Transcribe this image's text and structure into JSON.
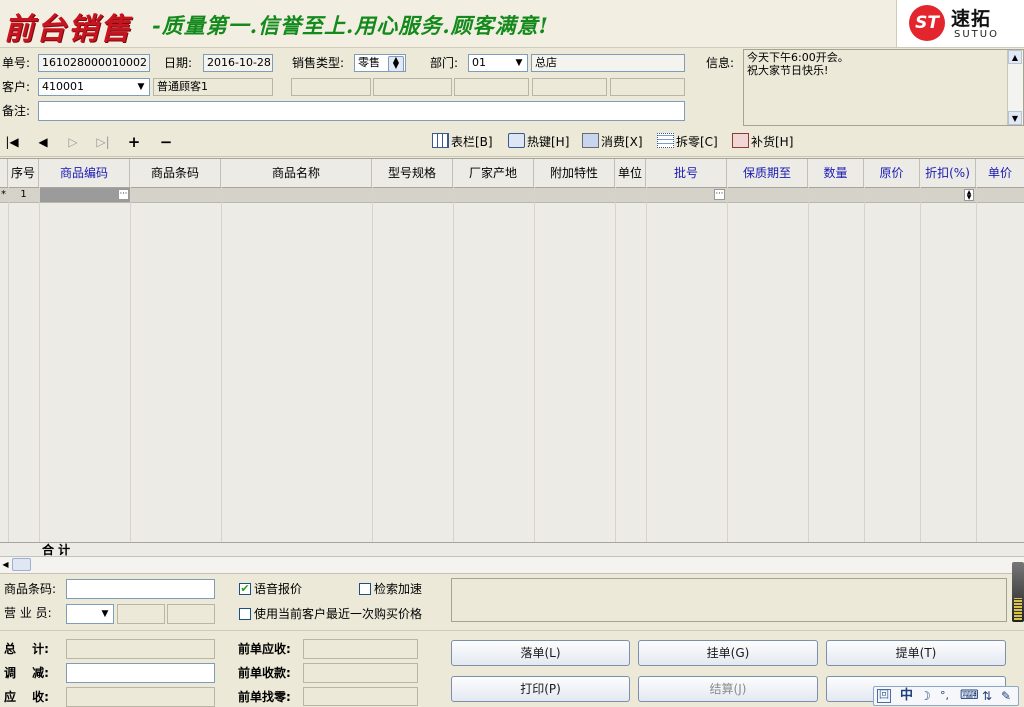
{
  "banner": {
    "title": "前台销售",
    "slogan": "-质量第一.信誉至上.用心服务.顾客满意!",
    "logo_mark": "ST",
    "logo_cn": "速拓",
    "logo_en": "SUTUO"
  },
  "form": {
    "order_no_label": "单号:",
    "order_no": "161028000010002",
    "date_label": "日期:",
    "date": "2016-10-28",
    "sale_type_label": "销售类型:",
    "sale_type": "零售",
    "dept_label": "部门:",
    "dept_code": "01",
    "dept_name": "总店",
    "info_label": "信息:",
    "info_line1": "今天下午6:00开会。",
    "info_line2": "祝大家节日快乐!",
    "customer_label": "客户:",
    "customer_code": "410001",
    "customer_name": "普通顾客1",
    "note_label": "备注:"
  },
  "toolbar": {
    "columns_btn": "表栏[B]",
    "hotkey_btn": "热键[H]",
    "consume_btn": "消费[X]",
    "split_btn": "拆零[C]",
    "restock_btn": "补货[H]",
    "first": "|◀",
    "prev": "◀",
    "next": "▷",
    "last": "▷|",
    "add": "+",
    "remove": "−"
  },
  "grid": {
    "columns": [
      "序号",
      "商品编码",
      "商品条码",
      "商品名称",
      "型号规格",
      "厂家产地",
      "附加特性",
      "单位",
      "批号",
      "保质期至",
      "数量",
      "原价",
      "折扣(%)",
      "单价"
    ],
    "row_marker": "*",
    "row_index": "1",
    "total_label": "合 计"
  },
  "entry": {
    "barcode_label": "商品条码:",
    "voice_label": "语音报价",
    "search_accel_label": "检索加速",
    "salesperson_label": "营 业 员:",
    "last_price_label": "使用当前客户最近一次购买价格"
  },
  "summary": {
    "total_label": "总　 计:",
    "adjust_label": "调　 减:",
    "receivable_label": "应　 收:",
    "prev_receivable_label": "前单应收:",
    "prev_received_label": "前单收款:",
    "prev_change_label": "前单找零:"
  },
  "buttons": {
    "drop_order": "落单(L)",
    "hold_order": "挂单(G)",
    "retrieve_order": "提单(T)",
    "print": "打印(P)",
    "settle": "结算(J)"
  },
  "ime": {
    "lang": "中",
    "moon": "☽",
    "dots": "°,",
    "keyboard": "⌨",
    "arrows": "⇅",
    "wrench": "✎"
  }
}
